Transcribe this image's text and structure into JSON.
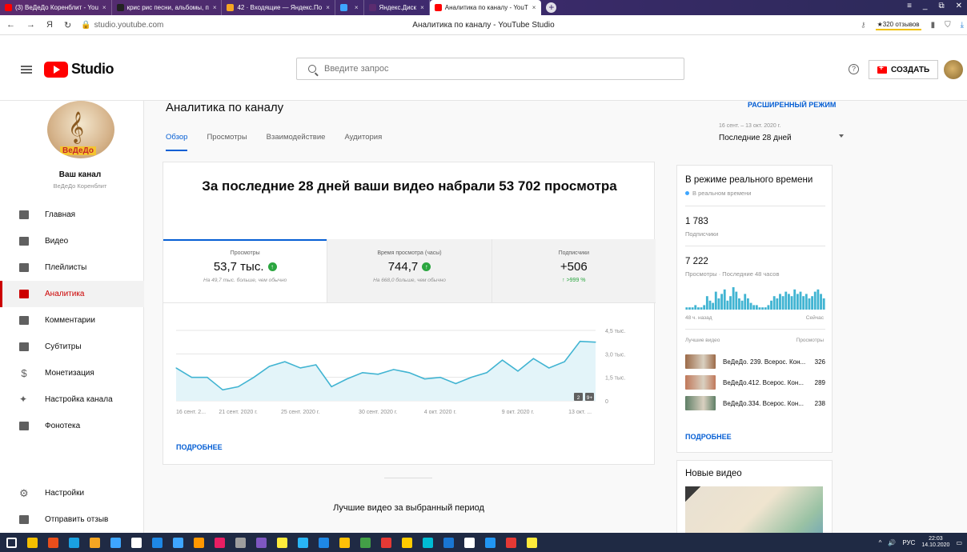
{
  "browser": {
    "tabs": [
      {
        "label": "(3) ВеДеДо Коренблит - You",
        "color": "#ff0000"
      },
      {
        "label": "крис рис песни, альбомы, п",
        "color": "#222222"
      },
      {
        "label": "42 · Входящие — Яндекс.По",
        "color": "#f5a623"
      },
      {
        "label": "",
        "color": "#3ea6ff"
      },
      {
        "label": "Яндекс.Диск",
        "color": "#5b2c6f"
      },
      {
        "label": "Аналитика по каналу - YouT",
        "color": "#ff0000"
      }
    ],
    "url": "studio.youtube.com",
    "page_title": "Аналитика по каналу - YouTube Studio",
    "reviews": "★320 отзывов",
    "nav": [
      "←",
      "→",
      "Я",
      "↻"
    ]
  },
  "header": {
    "logo_text": "Studio",
    "search_placeholder": "Введите запрос",
    "create_label": "СОЗДАТЬ"
  },
  "sidebar": {
    "channel_name": "Ваш канал",
    "channel_sub": "ВеДеДо Коренблит",
    "channel_brand": "ВеДеДо",
    "items": [
      {
        "label": "Главная",
        "icon": "dashboard-icon"
      },
      {
        "label": "Видео",
        "icon": "video-icon"
      },
      {
        "label": "Плейлисты",
        "icon": "playlist-icon"
      },
      {
        "label": "Аналитика",
        "icon": "analytics-icon"
      },
      {
        "label": "Комментарии",
        "icon": "comments-icon"
      },
      {
        "label": "Субтитры",
        "icon": "subtitles-icon"
      },
      {
        "label": "Монетизация",
        "icon": "dollar-icon"
      },
      {
        "label": "Настройка канала",
        "icon": "wand-icon"
      },
      {
        "label": "Фонотека",
        "icon": "audio-library-icon"
      }
    ],
    "bottom_items": [
      {
        "label": "Настройки",
        "icon": "gear-icon"
      },
      {
        "label": "Отправить отзыв",
        "icon": "feedback-icon"
      }
    ]
  },
  "main": {
    "title": "Аналитика по каналу",
    "advanced_mode": "РАСШИРЕННЫЙ РЕЖИМ",
    "tabs": [
      "Обзор",
      "Просмотры",
      "Взаимодействие",
      "Аудитория"
    ],
    "period_dates": "16 сент. – 13 окт. 2020 г.",
    "period_label": "Последние 28 дней",
    "headline": "За последние 28 дней ваши видео набрали 53 702 просмотра",
    "kpis": [
      {
        "label": "Просмотры",
        "value": "53,7 тыс.",
        "note": "На 49,7 тыс. больше, чем обычно"
      },
      {
        "label": "Время просмотра (часы)",
        "value": "744,7",
        "note": "На 668,0 больше, чем обычно"
      },
      {
        "label": "Подписчики",
        "value": "+506",
        "note": "↑ >999 %"
      }
    ],
    "more_label": "ПОДРОБНЕЕ",
    "best_videos_title": "Лучшие видео за выбранный период"
  },
  "chart_data": {
    "type": "area",
    "y_ticks": [
      "4,5 тыс.",
      "3,0 тыс.",
      "1,5 тыс.",
      "0"
    ],
    "x_ticks": [
      "16 сент. 2...",
      "21 сент. 2020 г.",
      "25 сент. 2020 г.",
      "30 сент. 2020 г.",
      "4 окт. 2020 г.",
      "9 окт. 2020 г.",
      "13 окт. ..."
    ],
    "ylim": [
      0,
      4500
    ],
    "values": [
      2100,
      1500,
      1500,
      700,
      900,
      1500,
      2200,
      2500,
      2100,
      2300,
      900,
      1400,
      1800,
      1700,
      2000,
      1800,
      1400,
      1500,
      1100,
      1500,
      1800,
      2600,
      1900,
      2700,
      2100,
      2500,
      3800,
      3750
    ],
    "badges": [
      "2",
      "9+"
    ],
    "line_color": "#41b4d2",
    "fill_color": "#e3f4f9"
  },
  "realtime": {
    "title": "В режиме реального времени",
    "live_label": "В реальном времени",
    "subscribers": "1 783",
    "subscribers_label": "Подписчики",
    "views": "7 222",
    "views_label": "Просмотры · Последние 48 часов",
    "axis_left": "48 ч. назад",
    "axis_right": "Сейчас",
    "col_video": "Лучшие видео",
    "col_views": "Просмотры",
    "bars": [
      0.1,
      0.1,
      0.1,
      0.2,
      0.1,
      0.1,
      0.2,
      0.6,
      0.4,
      0.3,
      0.8,
      0.5,
      0.7,
      0.9,
      0.4,
      0.6,
      1.0,
      0.8,
      0.5,
      0.4,
      0.7,
      0.5,
      0.3,
      0.2,
      0.2,
      0.1,
      0.1,
      0.1,
      0.2,
      0.4,
      0.6,
      0.5,
      0.7,
      0.6,
      0.8,
      0.7,
      0.6,
      0.9,
      0.7,
      0.8,
      0.6,
      0.7,
      0.5,
      0.6,
      0.8,
      0.9,
      0.7,
      0.5
    ],
    "bar_color": "#41b4d2",
    "videos": [
      {
        "title": "ВеДеДо. 239. Всерос. Кон...",
        "views": "326",
        "thumb": "#9c6a48"
      },
      {
        "title": "ВеДеДо.412. Всерос. Кон...",
        "views": "289",
        "thumb": "#c0785a"
      },
      {
        "title": "ВеДеДо.334. Всерос. Кон...",
        "views": "238",
        "thumb": "#5f7f66"
      }
    ],
    "more_label": "ПОДРОБНЕЕ"
  },
  "new_videos": {
    "title": "Новые видео"
  },
  "taskbar": {
    "lang": "РУС",
    "time": "22:03",
    "date": "14.10.2020",
    "icon_colors": [
      "#ffffff",
      "#f5c000",
      "#e84e1b",
      "#1aa1e1",
      "#f5a623",
      "#3ea6ff",
      "#ffffff",
      "#1e88e5",
      "#3ea6ff",
      "#ff9800",
      "#e91e63",
      "#9e9e9e",
      "#7e57c2",
      "#ffeb3b",
      "#29b6f6",
      "#1e88e5",
      "#ffc107",
      "#43a047",
      "#e53935",
      "#ffcc00",
      "#00bcd4",
      "#1976d2",
      "#ffffff",
      "#2196f3",
      "#e53935",
      "#ffeb3b"
    ]
  }
}
